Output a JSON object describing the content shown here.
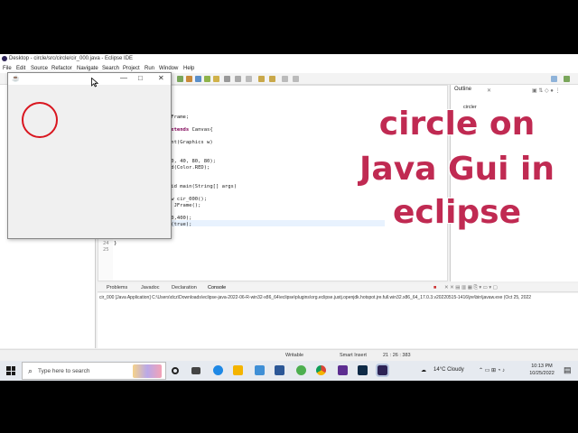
{
  "eclipse": {
    "title": "Desktop - circle/src/circle/cir_000.java - Eclipse IDE",
    "menu": [
      "File",
      "Edit",
      "Source",
      "Refactor",
      "Navigate",
      "Search",
      "Project",
      "Run",
      "Window",
      "Help"
    ]
  },
  "code_lines": [
    {
      "n": "",
      "text": "JFrame;"
    },
    {
      "n": "",
      "text": "0 extends Canvas{"
    },
    {
      "n": "",
      "text": "int(Graphics w)"
    },
    {
      "n": "",
      "text": "80, 40, 80, 80);"
    },
    {
      "n": "",
      "text": "nd(Color.RED);"
    },
    {
      "n": "",
      "text": "oid main(String[] args)"
    },
    {
      "n": "",
      "text": "ew cir_000();"
    },
    {
      "n": "",
      "text": "= JFrame();"
    },
    {
      "n": "",
      "text": "00,400);"
    },
    {
      "n": "",
      "text": "e(true);"
    },
    {
      "n": "24",
      "text": "}"
    },
    {
      "n": "25",
      "text": ""
    }
  ],
  "outline": {
    "tab": "Outline",
    "item": "circler"
  },
  "bottom_tabs": [
    "Problems",
    "Javadoc",
    "Declaration",
    "Console"
  ],
  "console_line": "cir_000 [Java Application] C:\\Users\\dcz\\Downloads\\eclipse-java-2022-06-R-win32-x86_64\\eclipse\\plugins\\org.eclipse.justj.openjdk.hotspot.jre.full.win32.x86_64_17.0.3.v20220515-1416\\jre\\bin\\javaw.exe  (Oct 25, 2022",
  "status": {
    "mode": "Writable",
    "insert": "Smart Insert",
    "pos": "21 : 26 : 383"
  },
  "jframe": {
    "controls": [
      "—",
      "□",
      "✕"
    ]
  },
  "caption": [
    "circle on",
    "Java Gui in",
    "eclipse"
  ],
  "taskbar": {
    "search_placeholder": "Type here to search",
    "weather": "14°C  Cloudy",
    "time": "10:13 PM",
    "date": "10/25/2022"
  },
  "colors": {
    "circle": "#d9161f",
    "caption": "#c02a52",
    "keyword": "#7f0055"
  }
}
